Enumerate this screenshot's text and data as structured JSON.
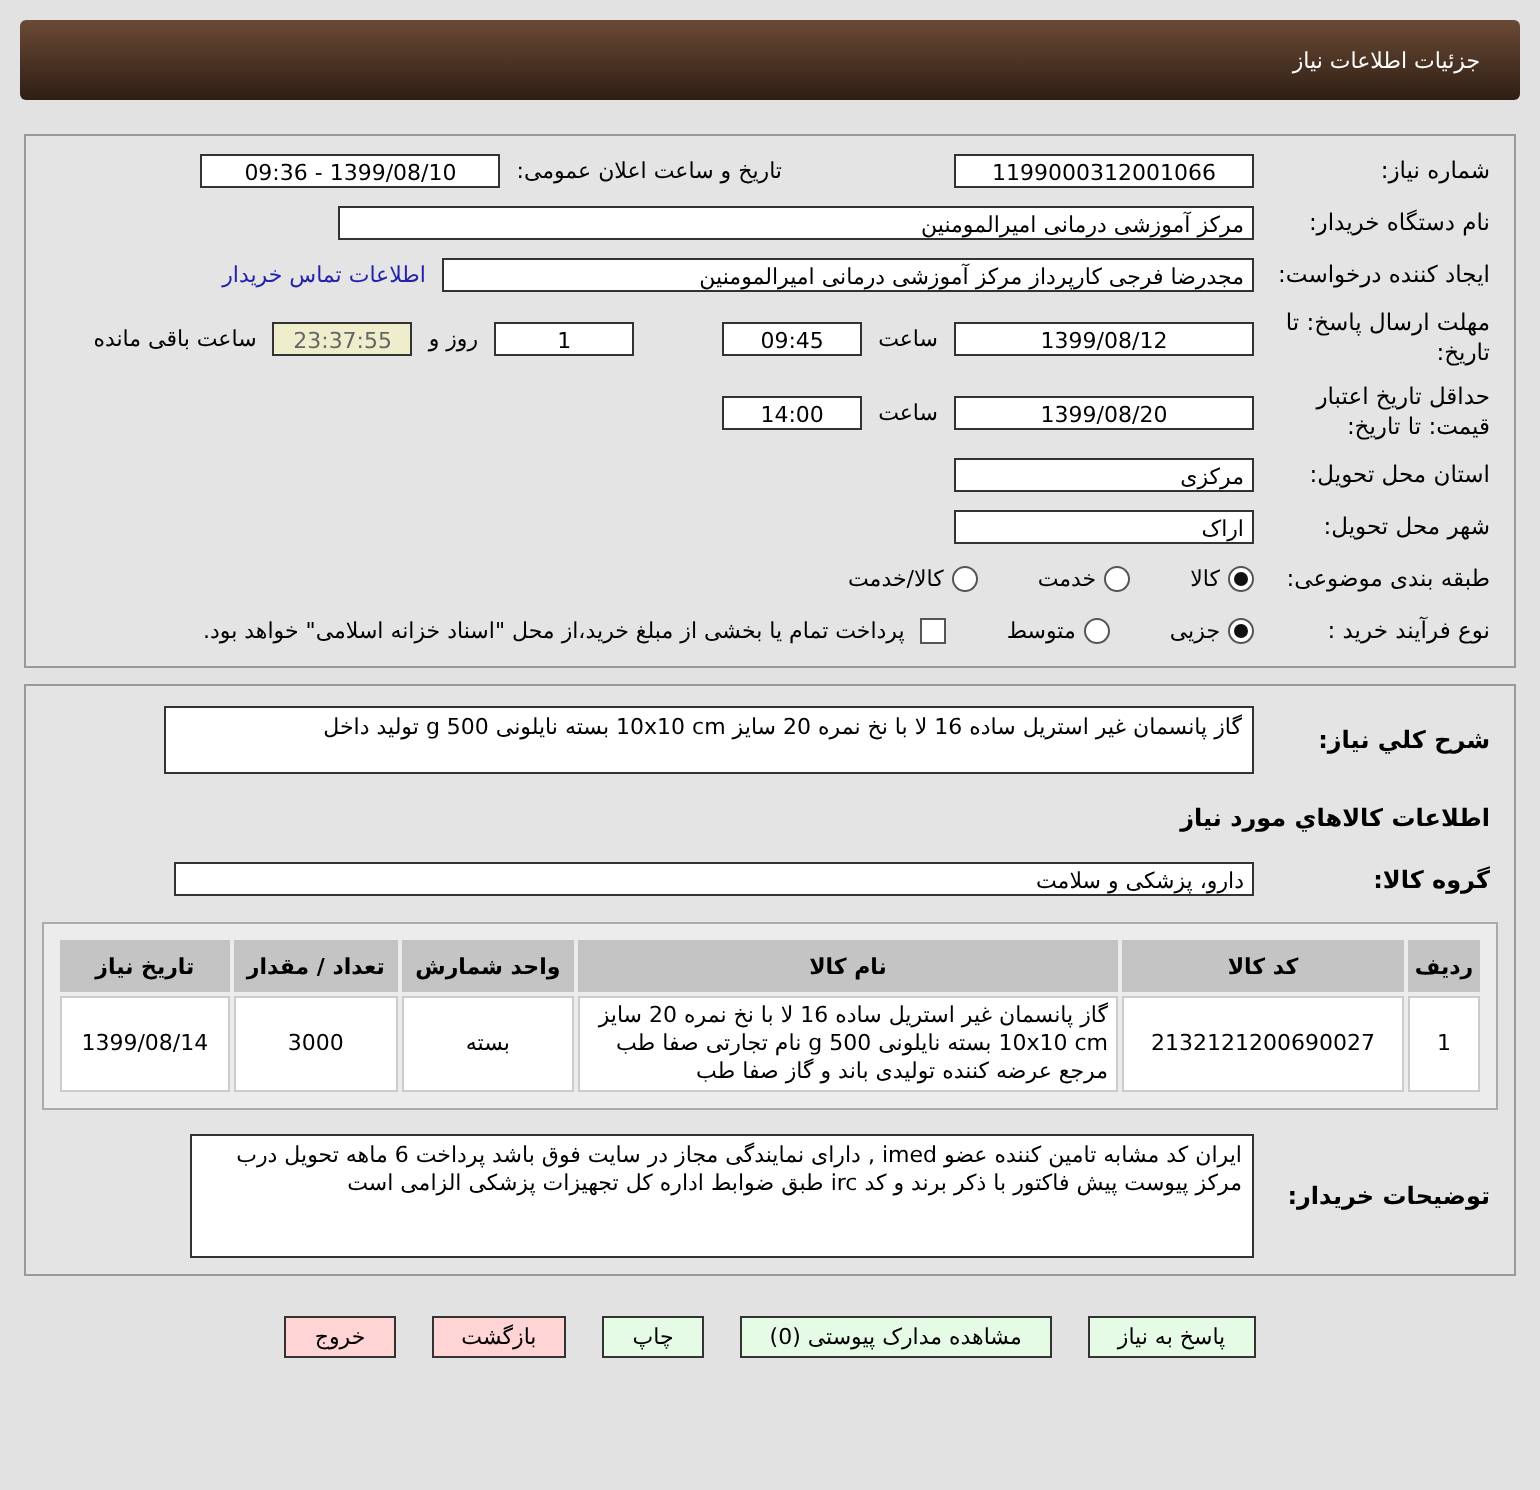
{
  "header": {
    "title": "جزئیات اطلاعات نیاز"
  },
  "details": {
    "need_number": {
      "label": "شماره نیاز:",
      "value": "1199000312001066"
    },
    "announce": {
      "label": "تاریخ و ساعت اعلان عمومی:",
      "value": "1399/08/10 - 09:36"
    },
    "buyer": {
      "label": "نام دستگاه خریدار:",
      "value": "مرکز آموزشی درمانی امیرالمومنین"
    },
    "creator": {
      "label": "ایجاد کننده درخواست:",
      "value": "مجدرضا فرجی کارپرداز مرکز آموزشی درمانی امیرالمومنین",
      "link": "اطلاعات تماس خریدار"
    },
    "deadline": {
      "label": "مهلت ارسال پاسخ: تا تاریخ:",
      "date": "1399/08/12",
      "time_label": "ساعت",
      "time": "09:45",
      "days": "1",
      "days_label": "روز و",
      "remaining": "23:37:55",
      "remaining_label": "ساعت باقی مانده"
    },
    "validity": {
      "label": "حداقل تاریخ اعتبار قیمت: تا تاریخ:",
      "date": "1399/08/20",
      "time_label": "ساعت",
      "time": "14:00"
    },
    "province": {
      "label": "استان محل تحویل:",
      "value": "مرکزی"
    },
    "city": {
      "label": "شهر محل تحویل:",
      "value": "اراک"
    },
    "category": {
      "label": "طبقه بندی موضوعی:",
      "options": [
        {
          "label": "کالا",
          "selected": true
        },
        {
          "label": "خدمت",
          "selected": false
        },
        {
          "label": "کالا/خدمت",
          "selected": false
        }
      ]
    },
    "process": {
      "label": "نوع فرآیند خرید :",
      "options": [
        {
          "label": "جزیی",
          "selected": true
        },
        {
          "label": "متوسط",
          "selected": false
        }
      ],
      "treasury": {
        "label": "پرداخت تمام یا بخشی از مبلغ خرید،از محل \"اسناد خزانه اسلامی\" خواهد بود.",
        "checked": false
      }
    }
  },
  "needs": {
    "description": {
      "label": "شرح کلي نياز:",
      "value": "گاز پانسمان غیر استریل ساده 16 لا با نخ نمره 20 سایز 10x10 cm بسته نایلونی 500 g تولید داخل"
    },
    "goods_heading": "اطلاعات کالاهاي مورد نياز",
    "group": {
      "label": "گروه کالا:",
      "value": "دارو، پزشکی و سلامت"
    },
    "table": {
      "columns": [
        "رديف",
        "کد کالا",
        "نام کالا",
        "واحد شمارش",
        "تعداد / مقدار",
        "تاریخ نیاز"
      ],
      "rows": [
        [
          "1",
          "2132121200690027",
          "گاز پانسمان غیر استریل ساده 16 لا با نخ نمره 20 سایز 10x10 cm بسته نایلونی 500 g نام تجارتی صفا طب مرجع عرضه کننده تولیدی باند و گاز صفا طب",
          "بسته",
          "3000",
          "1399/08/14"
        ]
      ]
    },
    "buyer_notes": {
      "label": "توضیحات خریدار:",
      "value": "ایران کد مشابه تامین کننده عضو imed , دارای نمایندگی مجاز در سایت فوق باشد  پرداخت 6 ماهه تحویل درب مرکز پیوست پیش فاکتور با ذکر برند و کد irc  طبق ضوابط اداره کل تجهیزات پزشکی الزامی است"
    }
  },
  "buttons": [
    {
      "label": "پاسخ به نیاز",
      "kind": "action"
    },
    {
      "label": "مشاهده مدارک پیوستی (0)",
      "kind": "action"
    },
    {
      "label": "چاپ",
      "kind": "action"
    },
    {
      "label": "بازگشت",
      "kind": "danger"
    },
    {
      "label": "خروج",
      "kind": "danger"
    }
  ]
}
